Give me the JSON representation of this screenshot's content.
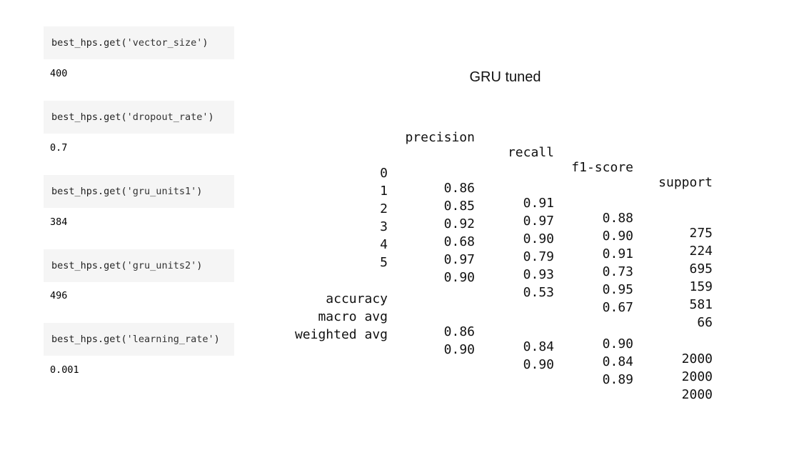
{
  "notebook": {
    "cells": [
      {
        "code_prefix": "best_hps.get(",
        "code_arg": "'vector_size'",
        "code_suffix": ")",
        "output": "400"
      },
      {
        "code_prefix": "best_hps.get(",
        "code_arg": "'dropout_rate'",
        "code_suffix": ")",
        "output": "0.7"
      },
      {
        "code_prefix": "best_hps.get(",
        "code_arg": "'gru_units1'",
        "code_suffix": ")",
        "output": "384"
      },
      {
        "code_prefix": "best_hps.get(",
        "code_arg": "'gru_units2'",
        "code_suffix": ")",
        "output": "496"
      },
      {
        "code_prefix": "best_hps.get(",
        "code_arg": "'learning_rate'",
        "code_suffix": ")",
        "output": "0.001"
      }
    ]
  },
  "report": {
    "title": "GRU tuned",
    "headers": {
      "precision": "precision",
      "recall": "recall",
      "f1": "f1-score",
      "support": "support"
    },
    "classes": [
      {
        "label": "0",
        "precision": "0.86",
        "recall": "0.91",
        "f1": "0.88",
        "support": "275"
      },
      {
        "label": "1",
        "precision": "0.85",
        "recall": "0.97",
        "f1": "0.90",
        "support": "224"
      },
      {
        "label": "2",
        "precision": "0.92",
        "recall": "0.90",
        "f1": "0.91",
        "support": "695"
      },
      {
        "label": "3",
        "precision": "0.68",
        "recall": "0.79",
        "f1": "0.73",
        "support": "159"
      },
      {
        "label": "4",
        "precision": "0.97",
        "recall": "0.93",
        "f1": "0.95",
        "support": "581"
      },
      {
        "label": "5",
        "precision": "0.90",
        "recall": "0.53",
        "f1": "0.67",
        "support": "66"
      }
    ],
    "summary": [
      {
        "label": "accuracy",
        "precision": "",
        "recall": "",
        "f1": "0.90",
        "support": "2000"
      },
      {
        "label": "macro avg",
        "precision": "0.86",
        "recall": "0.84",
        "f1": "0.84",
        "support": "2000"
      },
      {
        "label": "weighted avg",
        "precision": "0.90",
        "recall": "0.90",
        "f1": "0.89",
        "support": "2000"
      }
    ]
  }
}
